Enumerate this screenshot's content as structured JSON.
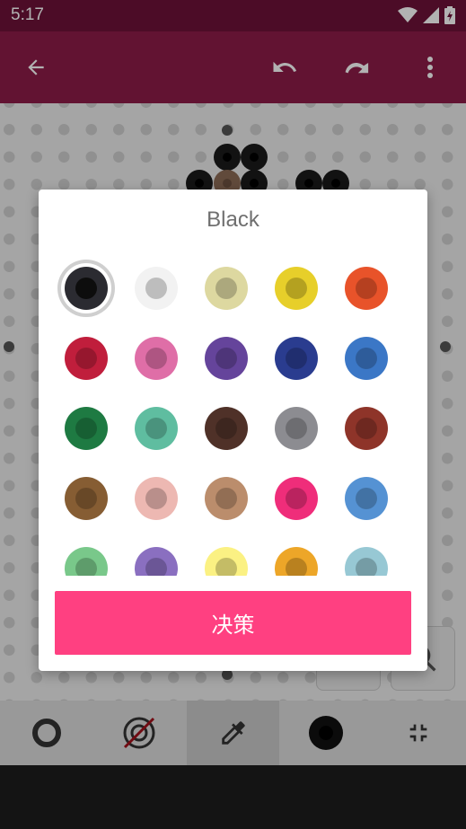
{
  "status_bar": {
    "time": "5:17",
    "icons": [
      "wifi-icon",
      "signal-icon",
      "battery-charging-icon"
    ]
  },
  "toolbar": {
    "icons": [
      "back-arrow-icon",
      "undo-icon",
      "redo-icon",
      "more-vert-icon"
    ]
  },
  "bottom_bar": {
    "icons": [
      "ring-icon",
      "crossed-target-icon",
      "eyedropper-icon",
      "black-bead-icon",
      "collapse-icon"
    ],
    "active_item": "eyedropper-icon"
  },
  "dialog": {
    "title": "Black",
    "confirm_label": "决策",
    "selected_color": "Black",
    "swatches": [
      "#2b2b31",
      "#f2f2f2",
      "#ddd8a0",
      "#e7cf2a",
      "#e8532a",
      "#c01e3c",
      "#df6ea7",
      "#65449b",
      "#2a3c8f",
      "#3b77c6",
      "#1e7a42",
      "#5fbda0",
      "#4f3128",
      "#8c8c91",
      "#8e3429",
      "#865d33",
      "#edb8b2",
      "#bb8d6c",
      "#ef2d7a",
      "#5592d3",
      "#79c88a",
      "#8a6fc0",
      "#fbf183",
      "#eda628",
      "#97c8d4"
    ]
  },
  "colors": {
    "status_bar": "#6d1238",
    "toolbar": "#8d1c48",
    "accent": "#ff4081"
  }
}
